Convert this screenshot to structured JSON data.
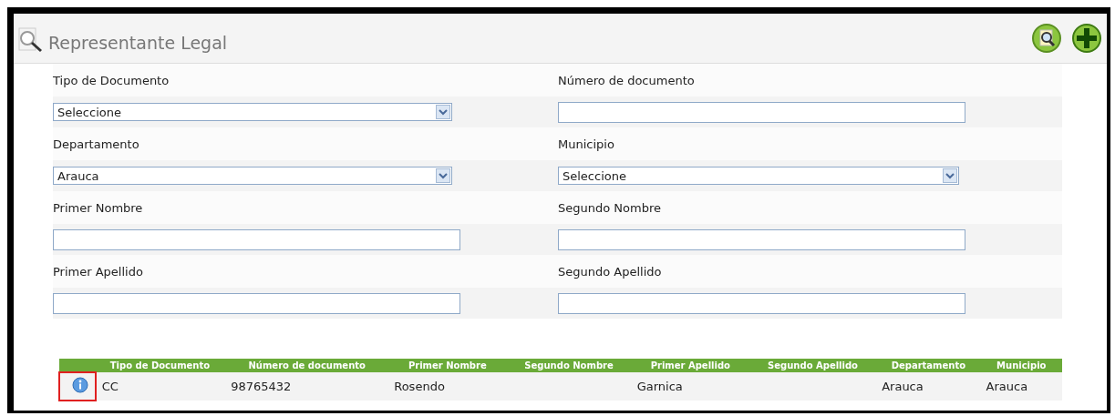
{
  "panel": {
    "title": "Representante Legal"
  },
  "form": {
    "rows": [
      {
        "left": {
          "label": "Tipo de Documento",
          "kind": "select",
          "value": "Seleccione"
        },
        "right": {
          "label": "Número de documento",
          "kind": "text"
        }
      },
      {
        "left": {
          "label": "Departamento",
          "kind": "select",
          "value": "Arauca"
        },
        "right": {
          "label": "Municipio",
          "kind": "select",
          "value": "Seleccione"
        }
      },
      {
        "left": {
          "label": "Primer Nombre",
          "kind": "text"
        },
        "right": {
          "label": "Segundo Nombre",
          "kind": "text"
        }
      },
      {
        "left": {
          "label": "Primer Apellido",
          "kind": "text"
        },
        "right": {
          "label": "Segundo Apellido",
          "kind": "text"
        }
      }
    ]
  },
  "table": {
    "columns": [
      "Tipo de Documento",
      "Número de documento",
      "Primer Nombre",
      "Segundo Nombre",
      "Primer Apellido",
      "Segundo Apellido",
      "Departamento",
      "Municipio"
    ],
    "rows": [
      {
        "highlighted": true,
        "cells": [
          "CC",
          "98765432",
          "Rosendo",
          "",
          "Garnica",
          "",
          "Arauca",
          "Arauca"
        ]
      }
    ]
  }
}
